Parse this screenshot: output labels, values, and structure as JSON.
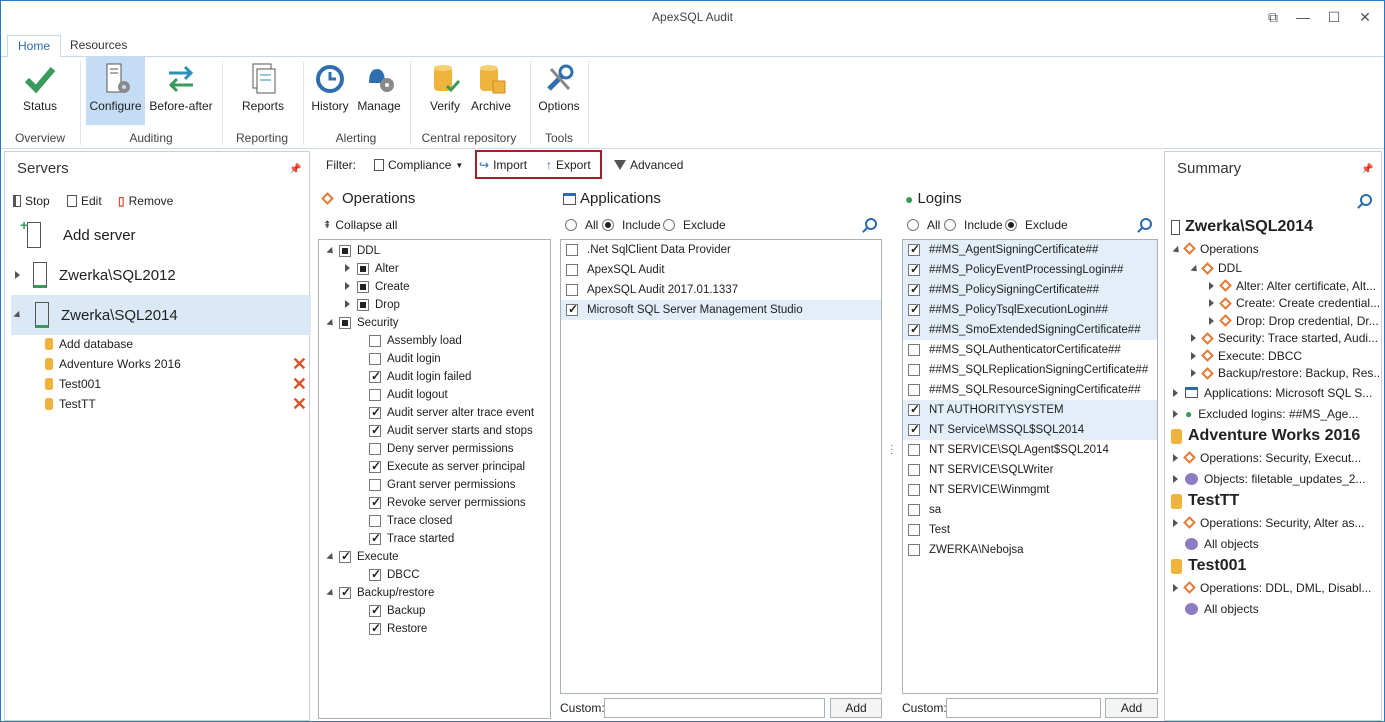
{
  "window": {
    "title": "ApexSQL Audit"
  },
  "ribbon": {
    "tabs": [
      "Home",
      "Resources"
    ],
    "buttons": {
      "status": "Status",
      "configure": "Configure",
      "before_after": "Before-after",
      "reports": "Reports",
      "history": "History",
      "manage": "Manage",
      "verify": "Verify",
      "archive": "Archive",
      "options": "Options"
    },
    "groups": {
      "overview": "Overview",
      "auditing": "Auditing",
      "reporting": "Reporting",
      "alerting": "Alerting",
      "central_repository": "Central repository",
      "tools": "Tools"
    }
  },
  "servers": {
    "title": "Servers",
    "toolbar": {
      "stop": "Stop",
      "edit": "Edit",
      "remove": "Remove"
    },
    "add_server": "Add server",
    "items": [
      "Zwerka\\SQL2012",
      "Zwerka\\SQL2014"
    ],
    "add_database": "Add database",
    "databases": [
      "Adventure Works 2016",
      "Test001",
      "TestTT"
    ]
  },
  "filter": {
    "label": "Filter:",
    "compliance": "Compliance",
    "import": "Import",
    "export": "Export",
    "advanced": "Advanced"
  },
  "operations": {
    "title": "Operations",
    "collapse_all": "Collapse all",
    "rows": [
      {
        "label": "DDL",
        "state": "partial",
        "level": 0,
        "exp": "d"
      },
      {
        "label": "Alter",
        "state": "partial",
        "level": 1,
        "exp": "r"
      },
      {
        "label": "Create",
        "state": "partial",
        "level": 1,
        "exp": "r"
      },
      {
        "label": "Drop",
        "state": "partial",
        "level": 1,
        "exp": "r"
      },
      {
        "label": "Security",
        "state": "partial",
        "level": 0,
        "exp": "d"
      },
      {
        "label": "Assembly load",
        "state": "none",
        "level": 2,
        "exp": ""
      },
      {
        "label": "Audit login",
        "state": "none",
        "level": 2,
        "exp": ""
      },
      {
        "label": "Audit login failed",
        "state": "checked",
        "level": 2,
        "exp": ""
      },
      {
        "label": "Audit logout",
        "state": "none",
        "level": 2,
        "exp": ""
      },
      {
        "label": "Audit server alter trace event",
        "state": "checked",
        "level": 2,
        "exp": ""
      },
      {
        "label": "Audit server starts and stops",
        "state": "checked",
        "level": 2,
        "exp": ""
      },
      {
        "label": "Deny server permissions",
        "state": "none",
        "level": 2,
        "exp": ""
      },
      {
        "label": "Execute as server principal",
        "state": "checked",
        "level": 2,
        "exp": ""
      },
      {
        "label": "Grant server permissions",
        "state": "none",
        "level": 2,
        "exp": ""
      },
      {
        "label": "Revoke server permissions",
        "state": "checked",
        "level": 2,
        "exp": ""
      },
      {
        "label": "Trace closed",
        "state": "none",
        "level": 2,
        "exp": ""
      },
      {
        "label": "Trace started",
        "state": "checked",
        "level": 2,
        "exp": ""
      },
      {
        "label": "Execute",
        "state": "checked",
        "level": 0,
        "exp": "d"
      },
      {
        "label": "DBCC",
        "state": "checked",
        "level": 2,
        "exp": ""
      },
      {
        "label": "Backup/restore",
        "state": "checked",
        "level": 0,
        "exp": "d"
      },
      {
        "label": "Backup",
        "state": "checked",
        "level": 2,
        "exp": ""
      },
      {
        "label": "Restore",
        "state": "checked",
        "level": 2,
        "exp": ""
      }
    ]
  },
  "applications": {
    "title": "Applications",
    "radios": [
      "All",
      "Include",
      "Exclude"
    ],
    "selected": "Include",
    "rows": [
      {
        "label": ".Net SqlClient Data Provider",
        "checked": false
      },
      {
        "label": "ApexSQL Audit",
        "checked": false
      },
      {
        "label": "ApexSQL Audit 2017.01.1337",
        "checked": false
      },
      {
        "label": "Microsoft SQL Server Management Studio",
        "checked": true
      }
    ],
    "custom_label": "Custom:",
    "add": "Add"
  },
  "logins": {
    "title": "Logins",
    "radios": [
      "All",
      "Include",
      "Exclude"
    ],
    "selected": "Exclude",
    "rows": [
      {
        "label": "##MS_AgentSigningCertificate##",
        "checked": true
      },
      {
        "label": "##MS_PolicyEventProcessingLogin##",
        "checked": true
      },
      {
        "label": "##MS_PolicySigningCertificate##",
        "checked": true
      },
      {
        "label": "##MS_PolicyTsqlExecutionLogin##",
        "checked": true
      },
      {
        "label": "##MS_SmoExtendedSigningCertificate##",
        "checked": true
      },
      {
        "label": "##MS_SQLAuthenticatorCertificate##",
        "checked": false
      },
      {
        "label": "##MS_SQLReplicationSigningCertificate##",
        "checked": false
      },
      {
        "label": "##MS_SQLResourceSigningCertificate##",
        "checked": false
      },
      {
        "label": "NT AUTHORITY\\SYSTEM",
        "checked": true
      },
      {
        "label": "NT Service\\MSSQL$SQL2014",
        "checked": true
      },
      {
        "label": "NT SERVICE\\SQLAgent$SQL2014",
        "checked": false
      },
      {
        "label": "NT SERVICE\\SQLWriter",
        "checked": false
      },
      {
        "label": "NT SERVICE\\Winmgmt",
        "checked": false
      },
      {
        "label": "sa",
        "checked": false
      },
      {
        "label": "Test",
        "checked": false
      },
      {
        "label": "ZWERKA\\Nebojsa",
        "checked": false
      }
    ],
    "custom_label": "Custom:",
    "add": "Add"
  },
  "summary": {
    "title": "Summary",
    "rows": [
      {
        "label": "Zwerka\\SQL2014",
        "kind": "big",
        "indent": 0,
        "exp": "",
        "icon": "server"
      },
      {
        "label": "Operations",
        "kind": "",
        "indent": 1,
        "exp": "d",
        "icon": "diamond"
      },
      {
        "label": "DDL",
        "kind": "",
        "indent": 2,
        "exp": "d",
        "icon": "diamond"
      },
      {
        "label": "Alter: Alter certificate, Alt...",
        "kind": "",
        "indent": 3,
        "exp": "r",
        "icon": "diamond"
      },
      {
        "label": "Create: Create credential...",
        "kind": "",
        "indent": 3,
        "exp": "r",
        "icon": "diamond"
      },
      {
        "label": "Drop: Drop credential, Dr...",
        "kind": "",
        "indent": 3,
        "exp": "r",
        "icon": "diamond"
      },
      {
        "label": "Security: Trace started, Audi...",
        "kind": "",
        "indent": 2,
        "exp": "r",
        "icon": "diamond"
      },
      {
        "label": "Execute: DBCC",
        "kind": "",
        "indent": 2,
        "exp": "r",
        "icon": "diamond"
      },
      {
        "label": "Backup/restore: Backup, Res...",
        "kind": "",
        "indent": 2,
        "exp": "r",
        "icon": "diamond"
      },
      {
        "label": "Applications: Microsoft SQL S...",
        "kind": "",
        "indent": 1,
        "exp": "r",
        "icon": "window"
      },
      {
        "label": "Excluded logins: ##MS_Age...",
        "kind": "",
        "indent": 1,
        "exp": "r",
        "icon": "users"
      },
      {
        "label": "Adventure Works 2016",
        "kind": "big",
        "indent": 0,
        "exp": "",
        "icon": "db"
      },
      {
        "label": "Operations: Security, Execut...",
        "kind": "",
        "indent": 1,
        "exp": "r",
        "icon": "diamond"
      },
      {
        "label": "Objects: filetable_updates_2...",
        "kind": "",
        "indent": 1,
        "exp": "r",
        "icon": "objects"
      },
      {
        "label": "TestTT",
        "kind": "big",
        "indent": 0,
        "exp": "",
        "icon": "db"
      },
      {
        "label": "Operations: Security, Alter as...",
        "kind": "",
        "indent": 1,
        "exp": "r",
        "icon": "diamond"
      },
      {
        "label": "All objects",
        "kind": "",
        "indent": 1,
        "exp": "",
        "icon": "objects"
      },
      {
        "label": "Test001",
        "kind": "big",
        "indent": 0,
        "exp": "",
        "icon": "db"
      },
      {
        "label": "Operations: DDL, DML, Disabl...",
        "kind": "",
        "indent": 1,
        "exp": "r",
        "icon": "diamond"
      },
      {
        "label": "All objects",
        "kind": "",
        "indent": 1,
        "exp": "",
        "icon": "objects"
      }
    ]
  },
  "colors": {
    "accent": "#2b6cb0",
    "selection": "#c5ddf4",
    "highlight_box": "#a3202a",
    "remove": "#d9532c"
  }
}
